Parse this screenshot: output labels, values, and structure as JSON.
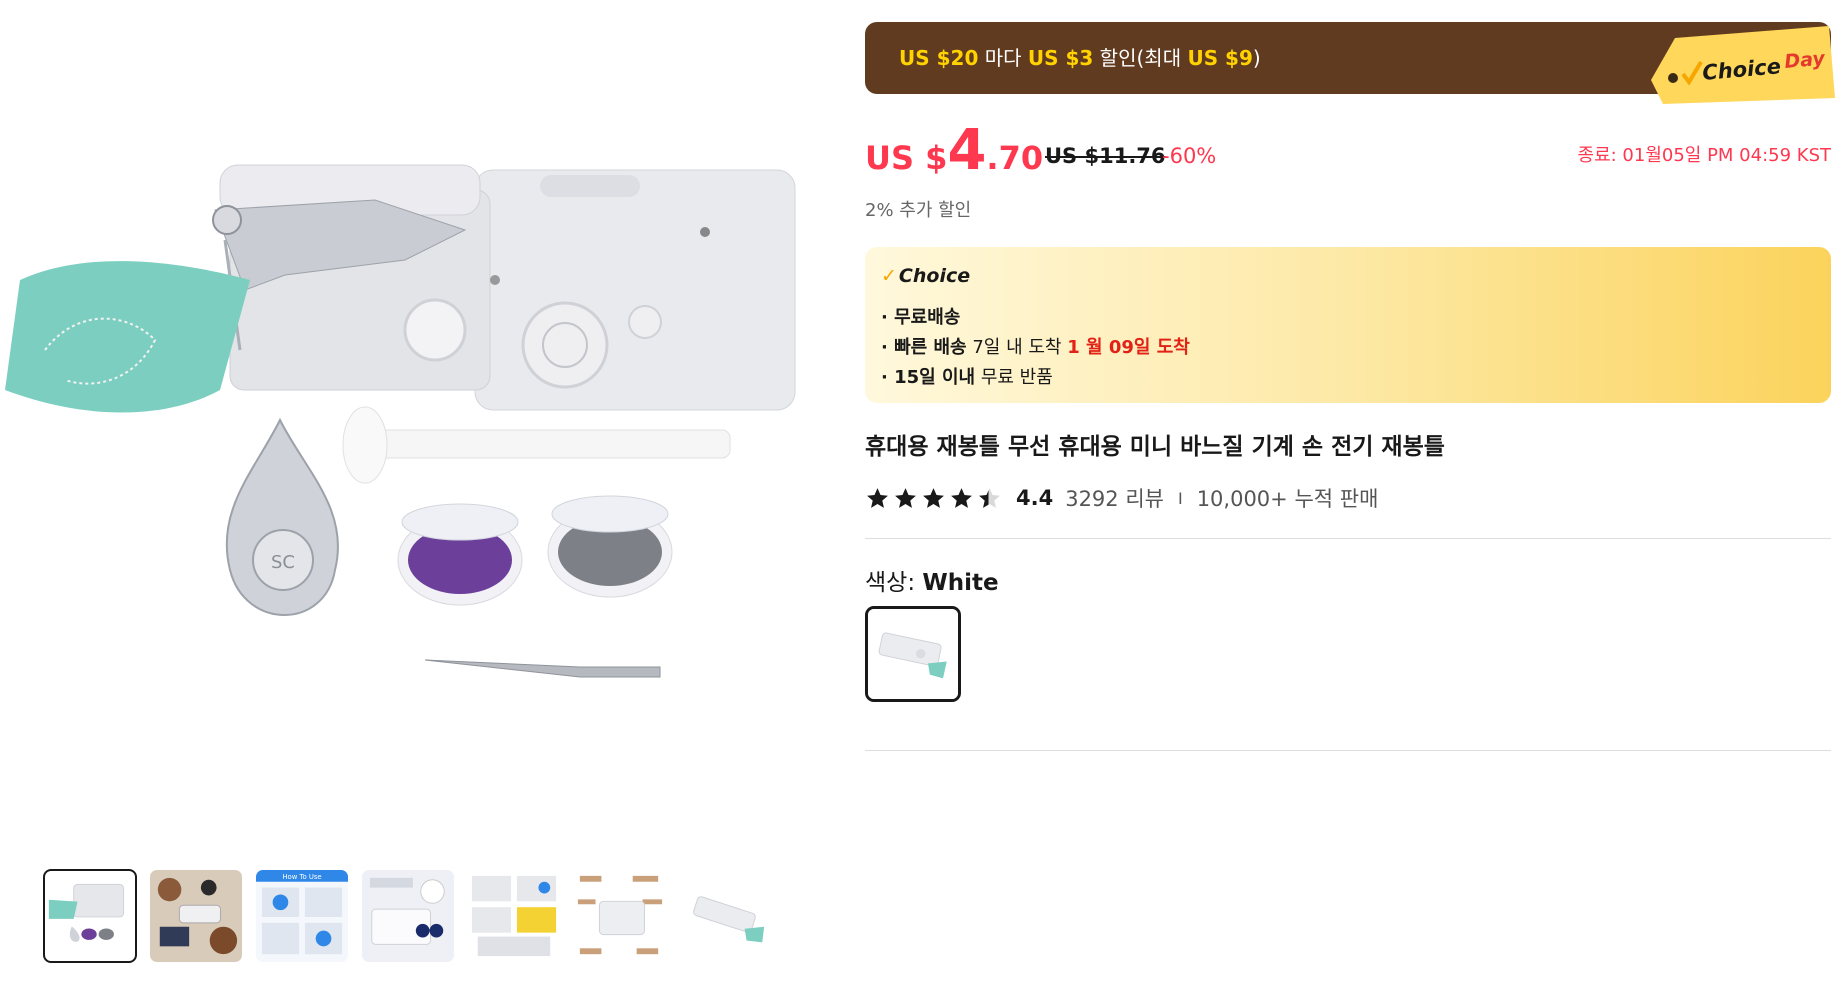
{
  "gallery": {
    "main_image": "handheld-sewing-machine-kit-photo",
    "thumbnails": [
      "thumb-sewing-machine-kit",
      "thumb-lifestyle-scene",
      "thumb-how-to-use",
      "thumb-usage-steps",
      "thumb-detail-grid",
      "thumb-product-features",
      "thumb-sewing-machine-side"
    ],
    "thumb_how_to_use_caption": "How To Use",
    "active_thumbnail": 0
  },
  "promo_banner": {
    "part1": "US $20",
    "part2": " 마다 ",
    "part3": "US $3",
    "part4": " 할인(최대 ",
    "part5": "US $9",
    "part6": ")",
    "tag_choice": "Choice",
    "tag_day": "Day",
    "bg_color": "#613b1f",
    "highlight_color": "#ffd200"
  },
  "price": {
    "currency": "US $",
    "integer": "4",
    "decimal": ".70",
    "original": "US $11.76",
    "discount": "-60%",
    "end_time": "종료: 01월05일 PM 04:59 KST",
    "extra_discount": "2% 추가 할인",
    "color": "#fd384f"
  },
  "choice_benefits": {
    "logo": "Choice",
    "free_shipping": "· 무료배송",
    "fast_label": "· 빠른 배송",
    "fast_days": " 7일 내 도착 ",
    "fast_date": "1 월 09일 도착",
    "return_label": "· 15일 이내",
    "return_text": "  무료 반품"
  },
  "product": {
    "title": "휴대용 재봉틀 무선 휴대용 미니 바느질 기계 손 전기 재봉틀",
    "rating": 4.4,
    "rating_text": "4.4",
    "reviews": "3292 리뷰",
    "separator": "I",
    "sold": "10,000+ 누적 판매"
  },
  "color_selector": {
    "label": "색상: ",
    "value": "White",
    "options": [
      "White"
    ]
  }
}
